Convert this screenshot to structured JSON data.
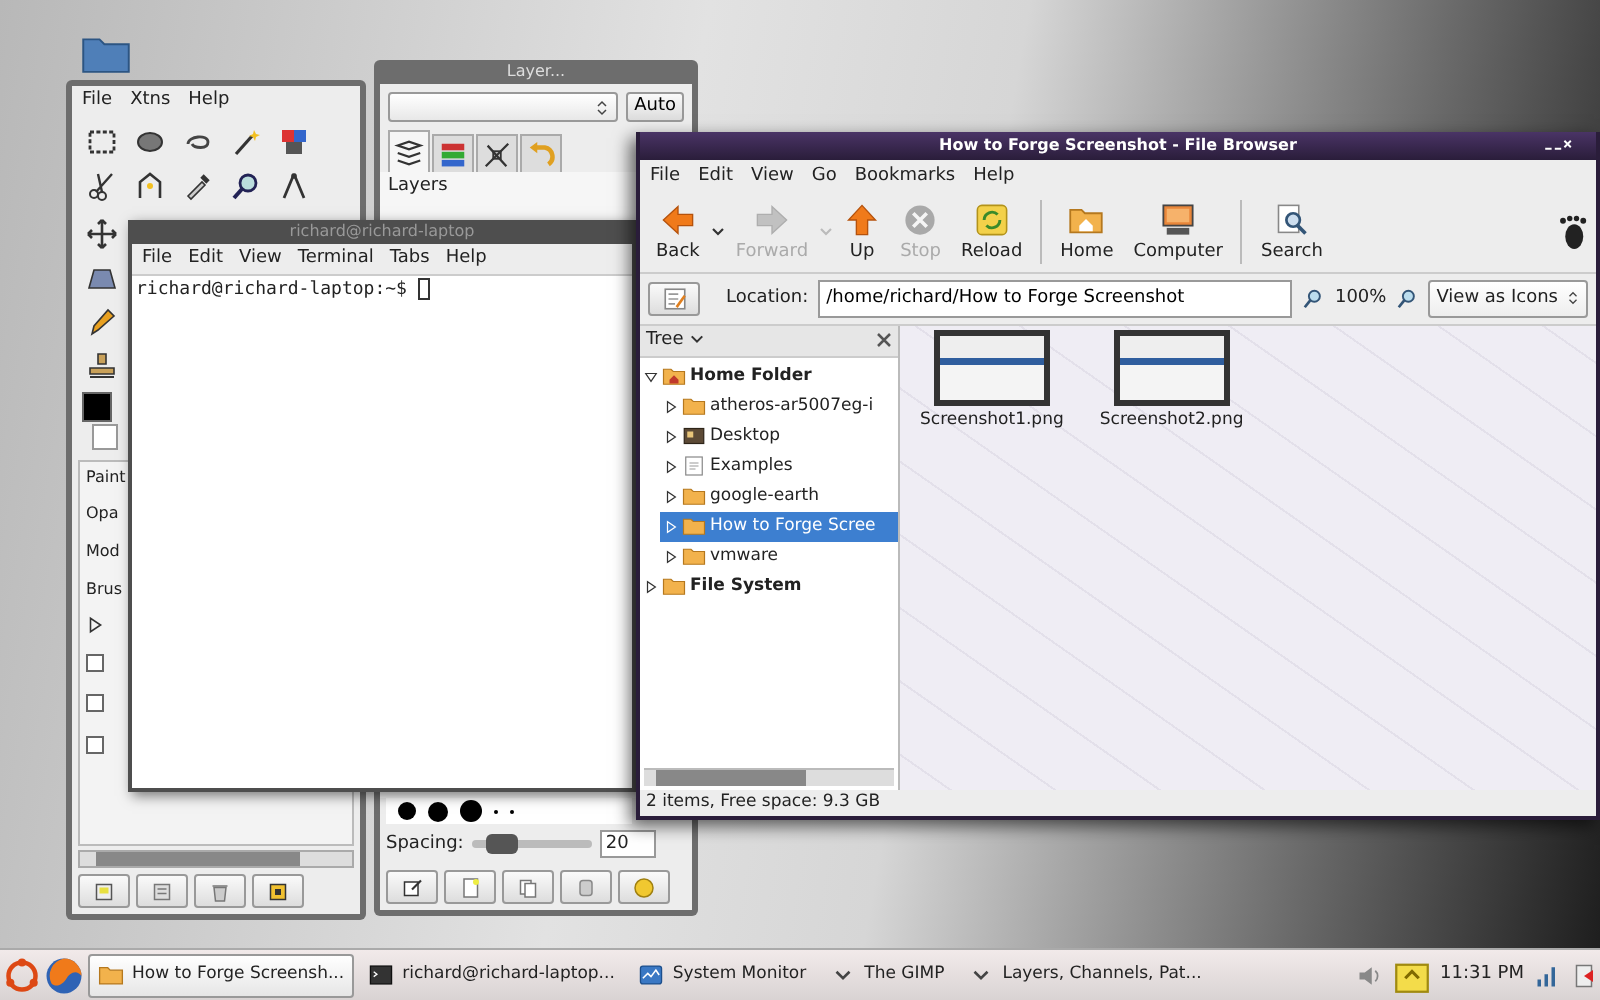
{
  "gimp_toolbox": {
    "menu": [
      "File",
      "Xtns",
      "Help"
    ],
    "tool_options": {
      "title": "Paint",
      "fields": [
        "Opa",
        "Mod",
        "Brus"
      ],
      "expander": {
        "expanded": false
      },
      "checkboxes": [
        {
          "checked": false
        },
        {
          "checked": false
        },
        {
          "checked": false
        }
      ]
    }
  },
  "layers_dialog": {
    "title": "Layer...",
    "auto_button": "Auto",
    "tabs": [
      {
        "selected": true
      },
      {
        "selected": false
      },
      {
        "selected": false
      },
      {
        "selected": false
      }
    ],
    "heading": "Layers",
    "spacing": {
      "label": "Spacing:",
      "level": 0.15,
      "value": "20"
    }
  },
  "terminal": {
    "title": "richard@richard-laptop",
    "menu": [
      "File",
      "Edit",
      "View",
      "Terminal",
      "Tabs",
      "Help"
    ],
    "prompt": "richard@richard-laptop:~$"
  },
  "file_browser": {
    "title": "How to Forge Screenshot - File Browser",
    "menu": [
      "File",
      "Edit",
      "View",
      "Go",
      "Bookmarks",
      "Help"
    ],
    "toolbar": [
      {
        "kind": "back",
        "label": "Back",
        "disabled": false,
        "dropdown": true,
        "separator_before": false
      },
      {
        "kind": "forward",
        "label": "Forward",
        "disabled": true,
        "dropdown": true,
        "separator_before": false
      },
      {
        "kind": "up",
        "label": "Up",
        "disabled": false,
        "dropdown": false,
        "separator_before": false
      },
      {
        "kind": "stop",
        "label": "Stop",
        "disabled": true,
        "dropdown": false,
        "separator_before": false
      },
      {
        "kind": "reload",
        "label": "Reload",
        "disabled": false,
        "dropdown": false,
        "separator_before": false
      },
      {
        "kind": "home",
        "label": "Home",
        "disabled": false,
        "dropdown": false,
        "separator_before": true
      },
      {
        "kind": "computer",
        "label": "Computer",
        "disabled": false,
        "dropdown": false,
        "separator_before": false
      },
      {
        "kind": "search",
        "label": "Search",
        "disabled": false,
        "dropdown": false,
        "separator_before": true
      }
    ],
    "location": {
      "label": "Location:",
      "value": "/home/richard/How to Forge Screenshot"
    },
    "zoom": "100%",
    "view_mode": "View as Icons",
    "sidebar": {
      "title": "Tree",
      "tree": [
        {
          "kind": "home",
          "label": "Home Folder",
          "expanded": true,
          "selected": false,
          "children": [
            {
              "kind": "folder",
              "label": "atheros-ar5007eg-i",
              "expanded": false,
              "selected": false
            },
            {
              "kind": "desktop",
              "label": "Desktop",
              "expanded": false,
              "selected": false
            },
            {
              "kind": "document",
              "label": "Examples",
              "expanded": false,
              "selected": false
            },
            {
              "kind": "folder",
              "label": "google-earth",
              "expanded": false,
              "selected": false
            },
            {
              "kind": "folder",
              "label": "How to Forge Scree",
              "expanded": false,
              "selected": true
            },
            {
              "kind": "folder",
              "label": "vmware",
              "expanded": false,
              "selected": false
            }
          ]
        },
        {
          "kind": "folder",
          "label": "File System",
          "expanded": false,
          "selected": false
        }
      ]
    },
    "files": [
      {
        "name": "Screenshot1.png"
      },
      {
        "name": "Screenshot2.png"
      }
    ],
    "status_bar": "2 items, Free space: 9.3 GB"
  },
  "taskbar": {
    "tasks": [
      {
        "kind": "folder",
        "label": "How to Forge Screensh...",
        "selected": true
      },
      {
        "kind": "terminal",
        "label": "richard@richard-laptop...",
        "selected": false
      },
      {
        "kind": "monitor",
        "label": "System Monitor",
        "selected": false
      },
      {
        "kind": "minimized",
        "label": "The GIMP",
        "selected": false
      },
      {
        "kind": "minimized",
        "label": "Layers, Channels, Pat...",
        "selected": false
      }
    ],
    "clock": "11:31 PM"
  }
}
